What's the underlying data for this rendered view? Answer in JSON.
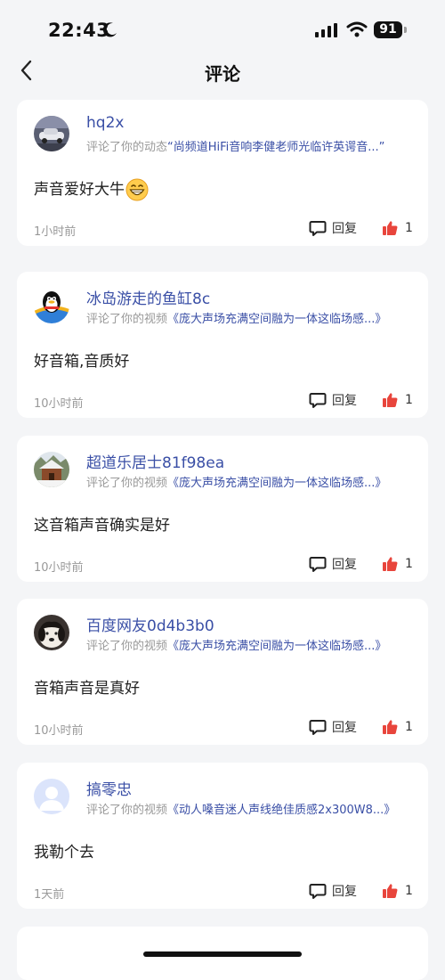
{
  "status_bar": {
    "time": "22:43",
    "battery": "91"
  },
  "nav": {
    "title": "评论"
  },
  "comments": [
    {
      "username": "hq2x",
      "action": "评论了你的动态",
      "target": "“尚频道HiFi音响李健老师光临许英谔音...”",
      "text": "声音爱好大牛",
      "time": "1小时前",
      "reply_label": "回复",
      "likes": "1"
    },
    {
      "username": "冰岛游走的鱼缸8c",
      "action": "评论了你的视频",
      "target": "《庞大声场充满空间融为一体这临场感...》",
      "text": "好音箱,音质好",
      "time": "10小时前",
      "reply_label": "回复",
      "likes": "1"
    },
    {
      "username": "超道乐居士81f98ea",
      "action": "评论了你的视频",
      "target": "《庞大声场充满空间融为一体这临场感...》",
      "text": "这音箱声音确实是好",
      "time": "10小时前",
      "reply_label": "回复",
      "likes": "1"
    },
    {
      "username": "百度网友0d4b3b0",
      "action": "评论了你的视频",
      "target": "《庞大声场充满空间融为一体这临场感...》",
      "text": "音箱声音是真好",
      "time": "10小时前",
      "reply_label": "回复",
      "likes": "1"
    },
    {
      "username": "搞零忠",
      "action": "评论了你的视频",
      "target": "《动人嗓音迷人声线绝佳质感2x300W8...》",
      "text": "我勒个去",
      "time": "1天前",
      "reply_label": "回复",
      "likes": "1"
    }
  ],
  "colors": {
    "link": "#3a4fa6",
    "like": "#e8453c",
    "meta": "#999999",
    "background": "#f4f5f7"
  }
}
